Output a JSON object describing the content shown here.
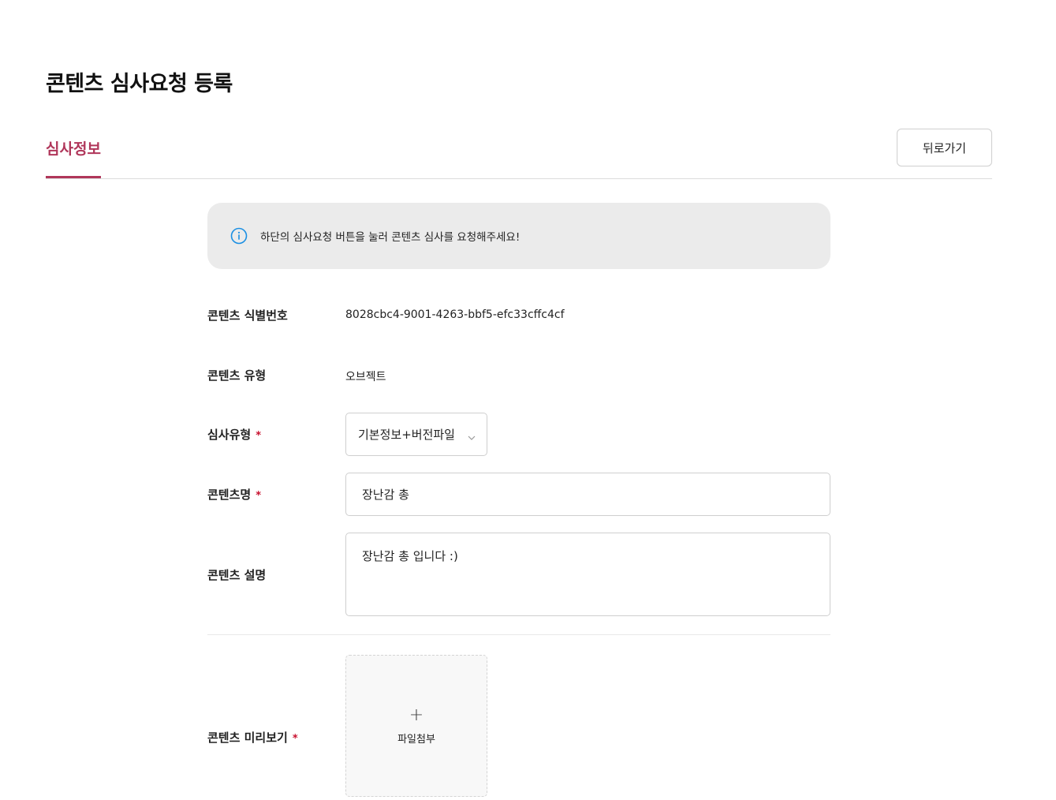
{
  "page": {
    "title": "콘텐츠 심사요청 등록"
  },
  "tabs": {
    "active_label": "심사정보",
    "accent_color": "#b0365a"
  },
  "back_button": {
    "label": "뒤로가기"
  },
  "notice": {
    "icon": "info-icon",
    "text": "하단의 심사요청 버튼을 눌러 콘텐츠 심사를 요청해주세요!",
    "icon_color": "#1a8fe3"
  },
  "form": {
    "content_id": {
      "label": "콘텐츠 식별번호",
      "value": "8028cbc4-9001-4263-bbf5-efc33cffc4cf"
    },
    "content_type": {
      "label": "콘텐츠 유형",
      "value": "오브젝트"
    },
    "review_type": {
      "label": "심사유형",
      "required_mark": "*",
      "selected": "기본정보+버전파일"
    },
    "content_name": {
      "label": "콘텐츠명",
      "required_mark": "*",
      "value": "장난감 총"
    },
    "content_description": {
      "label": "콘텐츠 설명",
      "value": "장난감 총 입니다 :)"
    },
    "preview": {
      "label": "콘텐츠 미리보기",
      "required_mark": "*",
      "upload_icon": "+",
      "upload_label": "파일첨부"
    }
  }
}
